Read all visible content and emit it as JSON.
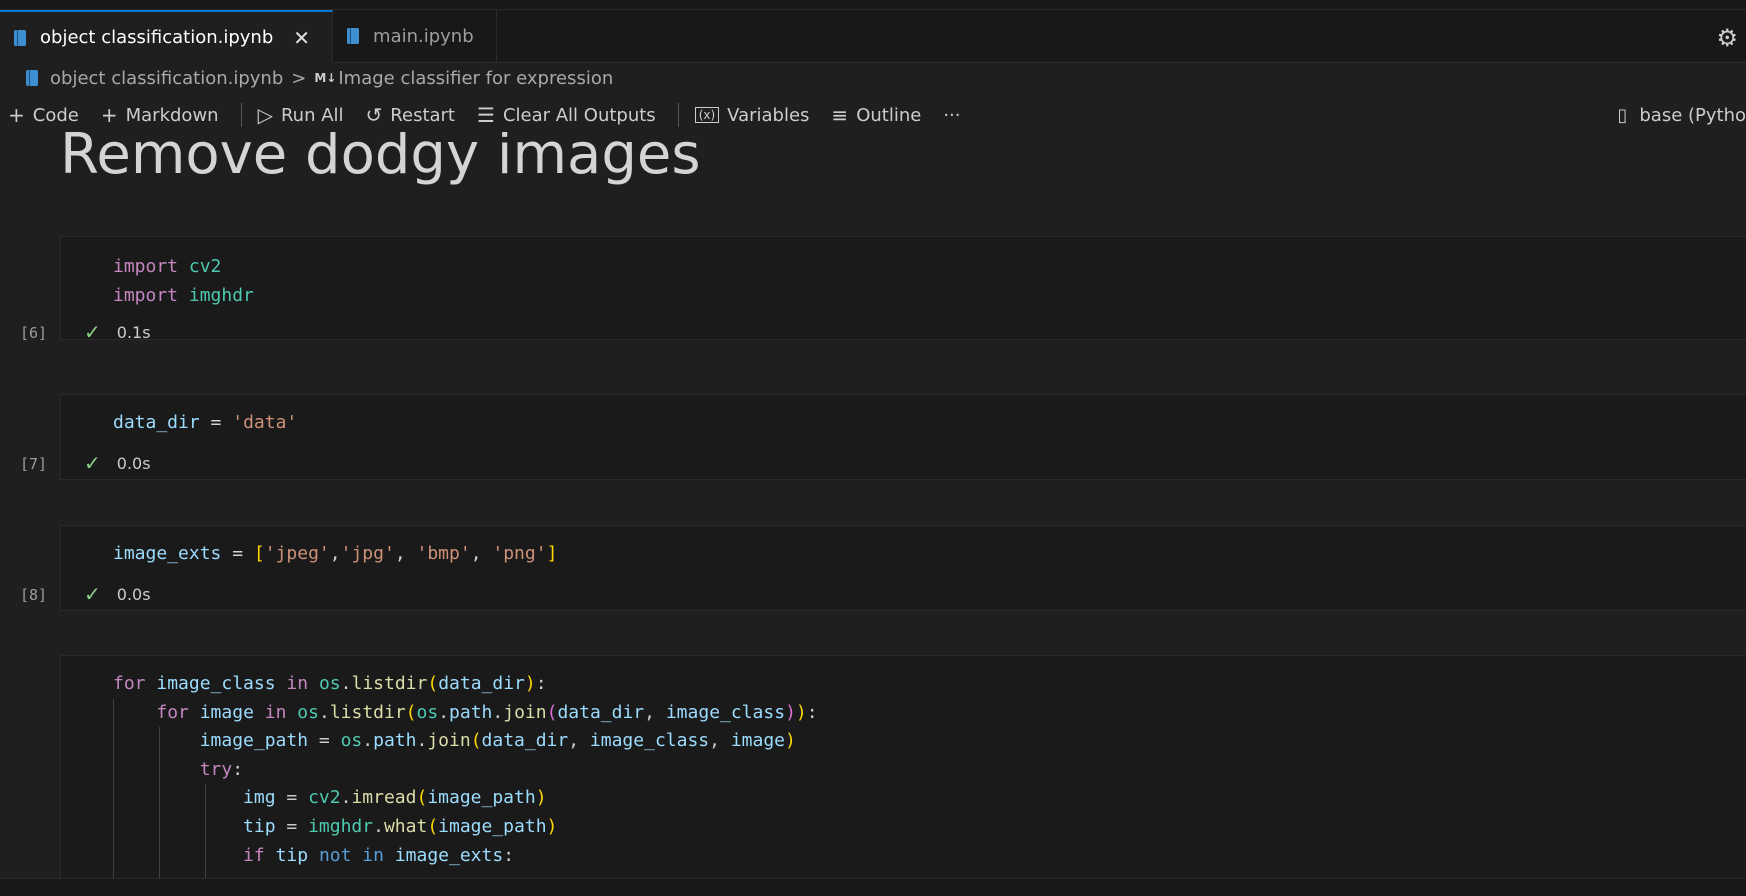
{
  "tabs": [
    {
      "label": "object classification.ipynb",
      "active": true
    },
    {
      "label": "main.ipynb",
      "active": false
    }
  ],
  "breadcrumb": {
    "file": "object classification.ipynb",
    "separator": ">",
    "markdown_badge": "M↓",
    "section": "Image classifier for expression"
  },
  "toolbar": {
    "code": "Code",
    "markdown": "Markdown",
    "run_all": "Run All",
    "restart": "Restart",
    "clear_outputs": "Clear All Outputs",
    "variables": "Variables",
    "outline": "Outline",
    "more": "···",
    "kernel": "base (Pytho"
  },
  "heading": "Remove dodgy images",
  "cells": [
    {
      "exec": "[6]",
      "time": "0.1s"
    },
    {
      "exec": "[7]",
      "time": "0.0s"
    },
    {
      "exec": "[8]",
      "time": "0.0s"
    }
  ],
  "code": {
    "c1": {
      "kw1": "import",
      "m1": "cv2",
      "kw2": "import",
      "m2": "imghdr"
    },
    "c2": {
      "v": "data_dir",
      "eq": "=",
      "s": "'data'"
    },
    "c3": {
      "v": "image_exts",
      "eq": "=",
      "s1": "'jpeg'",
      "s2": "'jpg'",
      "s3": "'bmp'",
      "s4": "'png'"
    },
    "c4": {
      "l1": {
        "kw": "for",
        "v": "image_class",
        "in": "in",
        "m": "os",
        "f": "listdir",
        "a": "data_dir"
      },
      "l2": {
        "kw": "for",
        "v": "image",
        "in": "in",
        "m1": "os",
        "f1": "listdir",
        "m2": "os",
        "p": "path",
        "f2": "join",
        "a1": "data_dir",
        "a2": "image_class"
      },
      "l3": {
        "v": "image_path",
        "m": "os",
        "p": "path",
        "f": "join",
        "a1": "data_dir",
        "a2": "image_class",
        "a3": "image"
      },
      "l4": {
        "kw": "try"
      },
      "l5": {
        "v": "img",
        "m": "cv2",
        "f": "imread",
        "a": "image_path"
      },
      "l6": {
        "v": "tip",
        "m": "imghdr",
        "f": "what",
        "a": "image_path"
      },
      "l7": {
        "kw": "if",
        "v": "tip",
        "not": "not",
        "in": "in",
        "a": "image_exts"
      }
    }
  }
}
